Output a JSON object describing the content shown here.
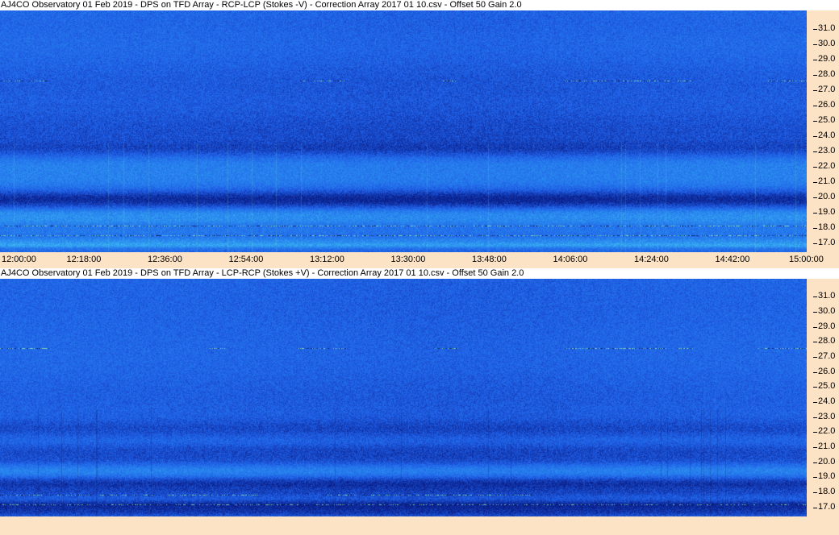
{
  "panels": [
    {
      "title": "AJ4CO Observatory 01 Feb 2019  -  DPS on TFD Array  -  RCP-LCP (Stokes -V)  -  Correction Array 2017 01 10.csv  -  Offset 50  Gain 2.0",
      "variant": "top"
    },
    {
      "title": "AJ4CO Observatory 01 Feb 2019  -  DPS on TFD Array  -  LCP-RCP (Stokes +V)  -  Correction Array 2017 01 10.csv  -  Offset 50  Gain 2.0",
      "variant": "bottom"
    }
  ],
  "chart_data": [
    {
      "type": "heatmap",
      "title": "AJ4CO Observatory 01 Feb 2019  -  DPS on TFD Array  -  RCP-LCP (Stokes -V)  -  Correction Array 2017 01 10.csv  -  Offset 50  Gain 2.0",
      "x_ticks": [
        "12:00:00",
        "12:18:00",
        "12:36:00",
        "12:54:00",
        "13:12:00",
        "13:30:00",
        "13:48:00",
        "14:06:00",
        "14:24:00",
        "14:42:00",
        "15:00:00"
      ],
      "y_ticks": [
        "31.0",
        "30.0",
        "29.0",
        "28.0",
        "27.0",
        "26.0",
        "25.0",
        "24.0",
        "23.0",
        "22.0",
        "21.0",
        "20.0",
        "19.0",
        "18.0",
        "17.0"
      ],
      "xlim": [
        "12:00:00",
        "15:00:00"
      ],
      "ylim": [
        16.4,
        32.2
      ],
      "colormap": [
        "#0a1f8a",
        "#1f5ee6",
        "#2a8cf0",
        "#45c9f0",
        "#9ef08a",
        "#f0e03c"
      ]
    },
    {
      "type": "heatmap",
      "title": "AJ4CO Observatory 01 Feb 2019  -  DPS on TFD Array  -  LCP-RCP (Stokes +V)  -  Correction Array 2017 01 10.csv  -  Offset 50  Gain 2.0",
      "x_ticks": [],
      "y_ticks": [
        "31.0",
        "30.0",
        "29.0",
        "28.0",
        "27.0",
        "26.0",
        "25.0",
        "24.0",
        "23.0",
        "22.0",
        "21.0",
        "20.0",
        "19.0",
        "18.0",
        "17.0"
      ],
      "ylim": [
        16.4,
        32.2
      ],
      "colormap": [
        "#0a1f8a",
        "#1f5ee6",
        "#2a8cf0",
        "#45c9f0",
        "#9ef08a",
        "#f0e03c"
      ]
    }
  ]
}
